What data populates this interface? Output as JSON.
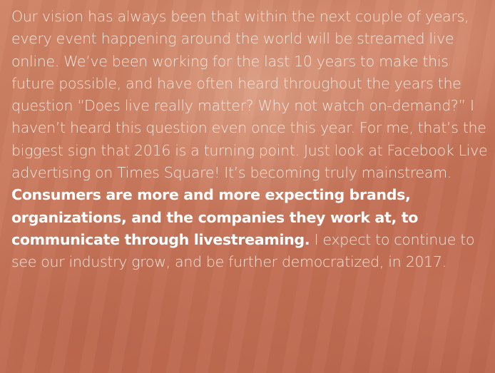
{
  "quote": {
    "intro": "Our vision has always been that within the next couple of years, every event happening around the world will be streamed live online. We’ve been working for the last 10 years to make this future possible, and have often heard throughout the years the question “Does live really matter? Why not watch on-demand?” I haven’t heard this question even once this year. For me, that’s the biggest sign that 2016 is a turning point. Just look at Facebook Live advertising on Times Square! It’s becoming truly mainstream.",
    "emphasis": "Consumers are more and more expecting brands, organizations, and the companies they work at, to communicate through livestreaming.",
    "closing": "I expect to continue to see our industry grow, and be further democratized, in 2017."
  }
}
